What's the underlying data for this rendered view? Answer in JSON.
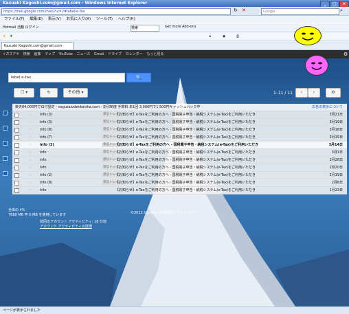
{
  "window": {
    "title": "Kazuaki Kagoshi.com@gmail.com - Windows Internet Explorer"
  },
  "address": {
    "url": "https://mail.google.com/mail/?ui=2#label/e-Tax"
  },
  "ie_search": {
    "placeholder": "Google"
  },
  "menu": [
    "ファイル(F)",
    "編集(E)",
    "表示(V)",
    "お気に入り(A)",
    "ツール(T)",
    "ヘルプ(H)"
  ],
  "toolbar": {
    "search_label": "検索",
    "search_value": "",
    "links": [
      "Hotmail 活動 ログイン",
      "Get more Add-ons"
    ]
  },
  "tab": {
    "label": "Kazuaki Kagoshi.com@gmail.com"
  },
  "gbar": {
    "items": [
      "+カズアキ",
      "検索",
      "画像",
      "マップ",
      "YouTube",
      "ニュース",
      "Gmail",
      "ドライブ",
      "カレンダー",
      "もっと見る"
    ]
  },
  "mail": {
    "search_value": "label:e-tax",
    "search_button": "🔍",
    "select_label": "☐ ▾",
    "refresh_label": "↻",
    "more_label": "その他 ▾",
    "pager_text": "1–11 / 11",
    "promo_text": "楽天84,000円で日付設定 - naguzaiodenkaisha.com - 割引制度 手数料 年1回 3,000円で1,500円キャッシュバック中",
    "promo_link": "広告の表示について",
    "rows": [
      {
        "from": "info (3)",
        "label": "受信トレイ",
        "subject": "【お知らせ】e-Taxをご利用の方へ - 国税電子申告・納税システム(e-Tax)をご利用いただき",
        "date": "3月21日",
        "unread": false
      },
      {
        "from": "info (3)",
        "label": "受信トレイ",
        "subject": "【お知らせ】e-Taxをご利用の方へ - 国税電子申告・納税システム(e-Tax)をご利用いただき",
        "date": "3月19日",
        "unread": false
      },
      {
        "from": "info (8)",
        "label": "受信トレイ",
        "subject": "【お知らせ】e-Taxをご利用の方へ - 国税電子申告・納税システム(e-Tax)をご利用いただき",
        "date": "3月18日",
        "unread": false
      },
      {
        "from": "info (7)",
        "label": "受信トレイ",
        "subject": "【お知らせ】e-Taxをご利用の方へ - 国税電子申告・納税システム(e-Tax)をご利用いただき",
        "date": "3月15日",
        "unread": false
      },
      {
        "from": "info (3)",
        "label": "受信トレイ",
        "subject": "【お知らせ】e-Taxをご利用の方へ - 国税電子申告・納税システム(e-Tax)をご利用いただき",
        "date": "3月14日",
        "unread": true
      },
      {
        "from": "info",
        "label": "受信トレイ",
        "subject": "【お知らせ】e-Taxをご利用の方へ - 国税電子申告・納税システム(e-Tax)をご利用いただき",
        "date": "3月1日",
        "unread": false
      },
      {
        "from": "info",
        "label": "受信トレイ",
        "subject": "【お知らせ】e-Taxをご利用の方へ - 国税電子申告・納税システム(e-Tax)をご利用いただき",
        "date": "2月26日",
        "unread": false
      },
      {
        "from": "info",
        "label": "受信トレイ",
        "subject": "【お知らせ】e-Taxをご利用の方へ - 国税電子申告・納税システム(e-Tax)をご利用いただき",
        "date": "2月20日",
        "unread": false
      },
      {
        "from": "info (2)",
        "label": "受信トレイ",
        "subject": "【お知らせ】e-Taxをご利用の方へ - 国税電子申告・納税システム(e-Tax)をご利用いただき",
        "date": "2月19日",
        "unread": false
      },
      {
        "from": "info (8)",
        "label": "受信トレイ",
        "subject": "【お知らせ】e-Taxをご利用の方へ - 国税電子申告・納税システム(e-Tax)をご利用いただき",
        "date": "2月8日",
        "unread": false
      },
      {
        "from": "info",
        "label": "",
        "subject": "【お知らせ】e-Taxをご利用の方へ - 国税電子申告・納税システム(e-Tax)をご利用いただき",
        "date": "1月23日",
        "unread": false
      }
    ],
    "footer_usage": "全体の 4%",
    "footer_usage2": "7680 MB 中 0 MB を使用しています",
    "footer_copyright": "©2013 Google - 利用規約とプライバシー",
    "footer_activity": "前回のアカウント アクティビティ: 16 分前",
    "footer_details": "アカウント アクティビティの詳細"
  },
  "status": {
    "text": "ページが表示されました"
  },
  "colors": {
    "titlebar": "#3a6fc0",
    "search_button": "#4d90fe",
    "gbar": "#2d2d2d",
    "smiley_yellow": "#ffff00",
    "smiley_pink": "#ff66ff"
  }
}
